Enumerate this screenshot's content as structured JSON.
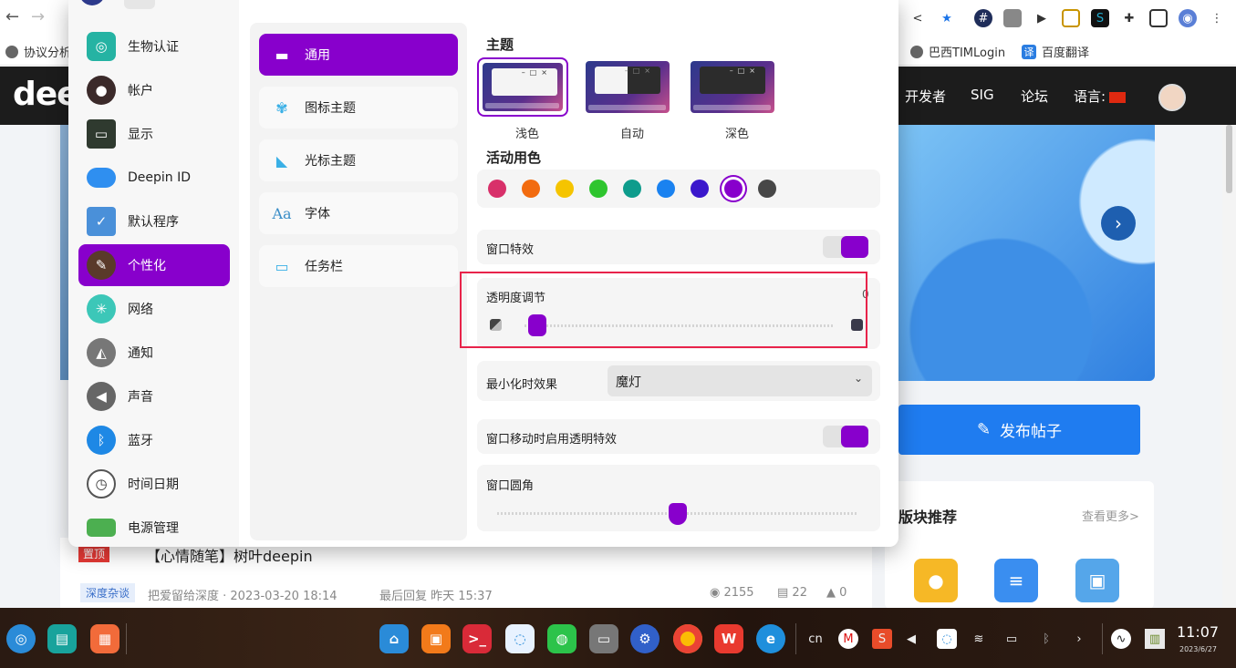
{
  "browser": {
    "nav": {
      "back": "←",
      "forward": "→"
    },
    "bookmarks": [
      {
        "label": "协议分析"
      },
      {
        "label": "巴西TIMLogin"
      },
      {
        "label": "百度翻译",
        "icon": "译"
      }
    ]
  },
  "site": {
    "logo": "dee",
    "nav": [
      "开发者",
      "SIG",
      "论坛"
    ],
    "language_label": "语言:",
    "publish_button": "发布帖子",
    "section_title": "版块推荐",
    "section_more": "查看更多>",
    "post": {
      "pin": "置顶",
      "title": "【心情随笔】树叶deepin",
      "category": "深度杂谈",
      "author_line": "把爱留给深度 · 2023-03-20 18:14",
      "last_reply": "最后回复 昨天 15:37",
      "views": "2155",
      "comments": "22",
      "reports": "0"
    }
  },
  "control_center": {
    "nav_items": [
      {
        "label": "生物认证",
        "icon": "fingerprint-icon",
        "color": "#25b3a3"
      },
      {
        "label": "帐户",
        "icon": "account-icon",
        "color": "#3b2a2a"
      },
      {
        "label": "显示",
        "icon": "display-icon",
        "color": "#2f3a2f"
      },
      {
        "label": "Deepin ID",
        "icon": "cloud-icon",
        "color": "#2f8ff0"
      },
      {
        "label": "默认程序",
        "icon": "default-apps-icon",
        "color": "#4a90d9"
      },
      {
        "label": "个性化",
        "icon": "personalization-icon",
        "color": "#5a3a2a"
      },
      {
        "label": "网络",
        "icon": "network-icon",
        "color": "#3cc7b8"
      },
      {
        "label": "通知",
        "icon": "bell-icon",
        "color": "#777777"
      },
      {
        "label": "声音",
        "icon": "speaker-icon",
        "color": "#666666"
      },
      {
        "label": "蓝牙",
        "icon": "bluetooth-icon",
        "color": "#1e88e5"
      },
      {
        "label": "时间日期",
        "icon": "clock-icon",
        "color": "#555555"
      },
      {
        "label": "电源管理",
        "icon": "battery-icon",
        "color": "#4caf50"
      }
    ],
    "active_nav": "个性化",
    "sub_items": [
      {
        "label": "通用",
        "icon": "window-icon"
      },
      {
        "label": "图标主题",
        "icon": "icon-theme-icon"
      },
      {
        "label": "光标主题",
        "icon": "cursor-icon"
      },
      {
        "label": "字体",
        "icon": "font-icon"
      },
      {
        "label": "任务栏",
        "icon": "taskbar-icon"
      }
    ],
    "active_sub": "通用",
    "theme": {
      "title": "主题",
      "options": [
        "浅色",
        "自动",
        "深色"
      ],
      "selected": "浅色"
    },
    "accent": {
      "title": "活动用色",
      "colors": [
        "#d8306a",
        "#f26b0f",
        "#f5c400",
        "#2ec52e",
        "#0e9c8c",
        "#1a82f0",
        "#3b18cc",
        "#8800cc",
        "#474747"
      ],
      "selected": "#8800cc"
    },
    "window_effect": {
      "label": "窗口特效",
      "on": true
    },
    "transparency": {
      "label": "透明度调节",
      "value": 0.05
    },
    "edge_text": "0",
    "minimize_effect": {
      "label": "最小化时效果",
      "value": "魔灯"
    },
    "move_transparency": {
      "label": "窗口移动时启用透明特效",
      "on": true
    },
    "corner": {
      "label": "窗口圆角",
      "value": 0.5
    }
  },
  "taskbar": {
    "tray_cn": "cn",
    "time": "11:07",
    "date": "2023/6/27"
  }
}
